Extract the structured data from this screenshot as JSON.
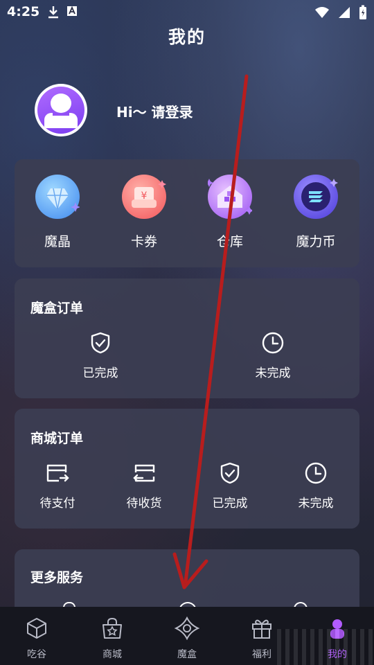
{
  "status": {
    "time": "4:25"
  },
  "page": {
    "title": "我的"
  },
  "user": {
    "login_prompt": "Hi～ 请登录"
  },
  "assets": [
    {
      "label": "魔晶",
      "icon": "crystal-icon"
    },
    {
      "label": "卡券",
      "icon": "coupon-icon"
    },
    {
      "label": "仓库",
      "icon": "warehouse-icon"
    },
    {
      "label": "魔力币",
      "icon": "coin-icon"
    }
  ],
  "box_orders": {
    "title": "魔盒订单",
    "items": [
      {
        "label": "已完成",
        "icon": "shield-check-icon"
      },
      {
        "label": "未完成",
        "icon": "clock-icon"
      }
    ]
  },
  "mall_orders": {
    "title": "商城订单",
    "items": [
      {
        "label": "待支付",
        "icon": "card-pay-icon"
      },
      {
        "label": "待收货",
        "icon": "card-receive-icon"
      },
      {
        "label": "已完成",
        "icon": "shield-check-icon"
      },
      {
        "label": "未完成",
        "icon": "clock-icon"
      }
    ]
  },
  "more_services": {
    "title": "更多服务"
  },
  "tabbar": [
    {
      "label": "吃谷",
      "icon": "cube-icon"
    },
    {
      "label": "商城",
      "icon": "shopping-bag-icon"
    },
    {
      "label": "魔盒",
      "icon": "magic-box-icon"
    },
    {
      "label": "福利",
      "icon": "gift-icon"
    },
    {
      "label": "我的",
      "icon": "profile-icon",
      "active": true
    }
  ],
  "colors": {
    "arrow": "#c0201e",
    "card": "#3c3e52",
    "tab_active": "#b25cff"
  }
}
